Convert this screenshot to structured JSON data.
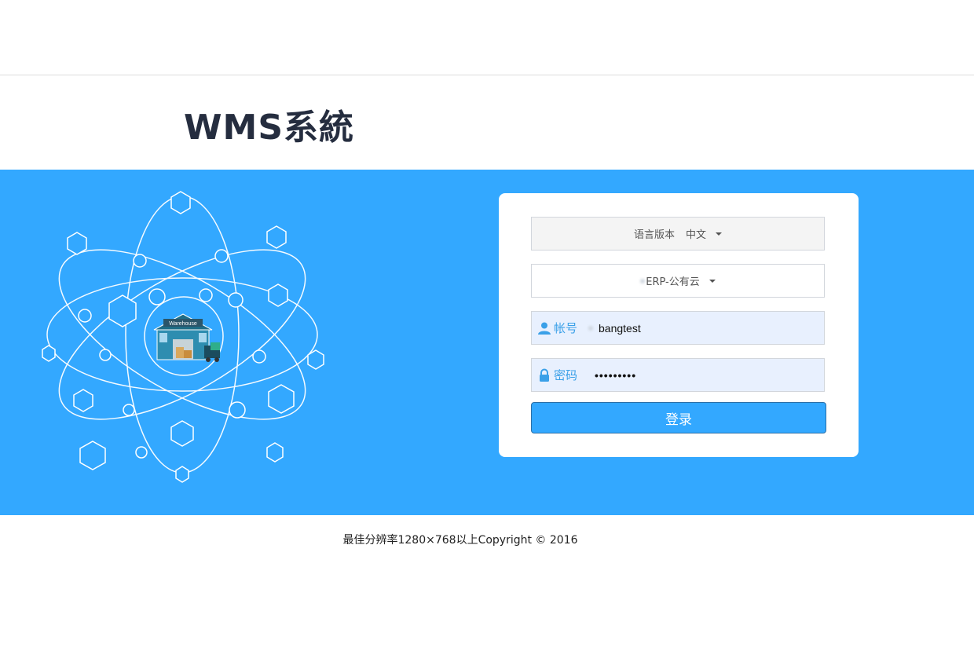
{
  "header": {
    "logo_text": "WMS系統"
  },
  "illustration": {
    "warehouse_sign": "Warehouse"
  },
  "login": {
    "language": {
      "label": "语言版本",
      "value": "中文"
    },
    "system": {
      "value": "ERP-公有云"
    },
    "account": {
      "label": "帐号",
      "value": "bangtest"
    },
    "password": {
      "label": "密码",
      "value": "•••••••••"
    },
    "submit_label": "登录"
  },
  "footer": {
    "text": "最佳分辨率1280×768以上Copyright © 2016"
  },
  "colors": {
    "banner": "#33a8ff",
    "logo": "#252d3f",
    "field_accent": "#3aa0e8",
    "input_fill": "#e8f0fe"
  }
}
